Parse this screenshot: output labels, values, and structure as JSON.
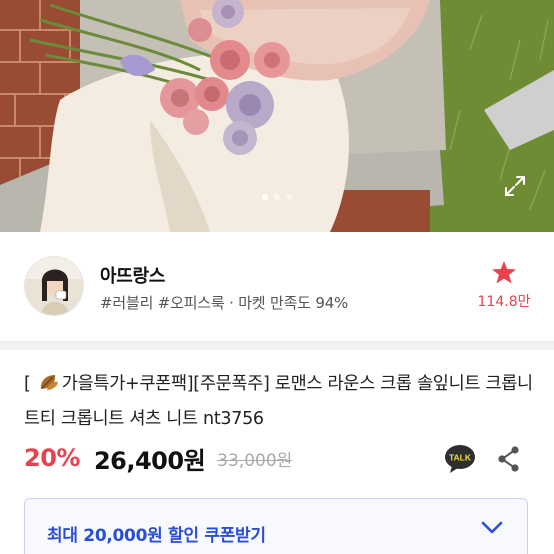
{
  "hero": {
    "image_description_icon": "product-photo",
    "carousel_page": 1,
    "carousel_total": 3
  },
  "seller": {
    "name": "아뜨랑스",
    "tags": "#러블리 #오피스룩 · 마켓 만족도 94%",
    "favorite_count": "114.8만"
  },
  "product": {
    "title_prefix": "[ ",
    "title_main": "가을특가+쿠폰팩][주문폭주] 로맨스 라운스 크롭 솔잎니트 크롭니트티 크롭니트 셔츠 니트 nt3756",
    "discount": "20%",
    "price": "26,400원",
    "original_price": "33,000원"
  },
  "actions": {
    "talk_label": "TALK"
  },
  "coupon": {
    "label": "최대 20,000원 할인 쿠폰받기"
  },
  "colors": {
    "accent_red": "#e8424f",
    "coupon_blue": "#2a4fd4"
  }
}
